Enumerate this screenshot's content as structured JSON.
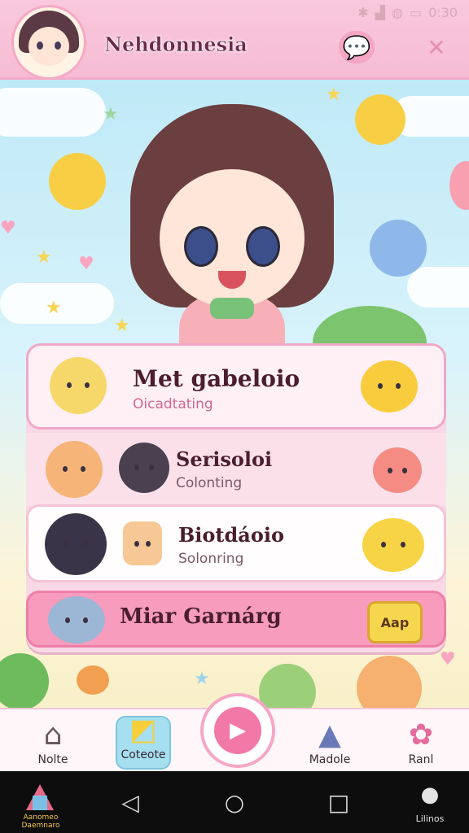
{
  "status_bar": {
    "time": "0:30"
  },
  "header": {
    "title": "Nehdonnesia"
  },
  "list": [
    {
      "title": "Met gabeloio",
      "subtitle": "Oicadtating"
    },
    {
      "title": "Serisoloi",
      "subtitle": "Colonting"
    },
    {
      "title": "Biotdáoio",
      "subtitle": "Solonring"
    },
    {
      "title": "Miar Garnárg",
      "button": "Aap"
    }
  ],
  "nav": [
    {
      "label": "Nolte",
      "icon": "home-icon"
    },
    {
      "label": "Coteote",
      "icon": "puzzle-icon"
    },
    {
      "label": "Madole",
      "icon": "bell-icon"
    },
    {
      "label": "Ranl",
      "icon": "gear-icon"
    }
  ],
  "system_nav": {
    "logo_label": "Aanomeo Daemnaro",
    "user_label": "Lilinos"
  },
  "colors": {
    "header": "#f8c4da",
    "accent": "#f278a8",
    "active_tab": "#a6dff0"
  }
}
